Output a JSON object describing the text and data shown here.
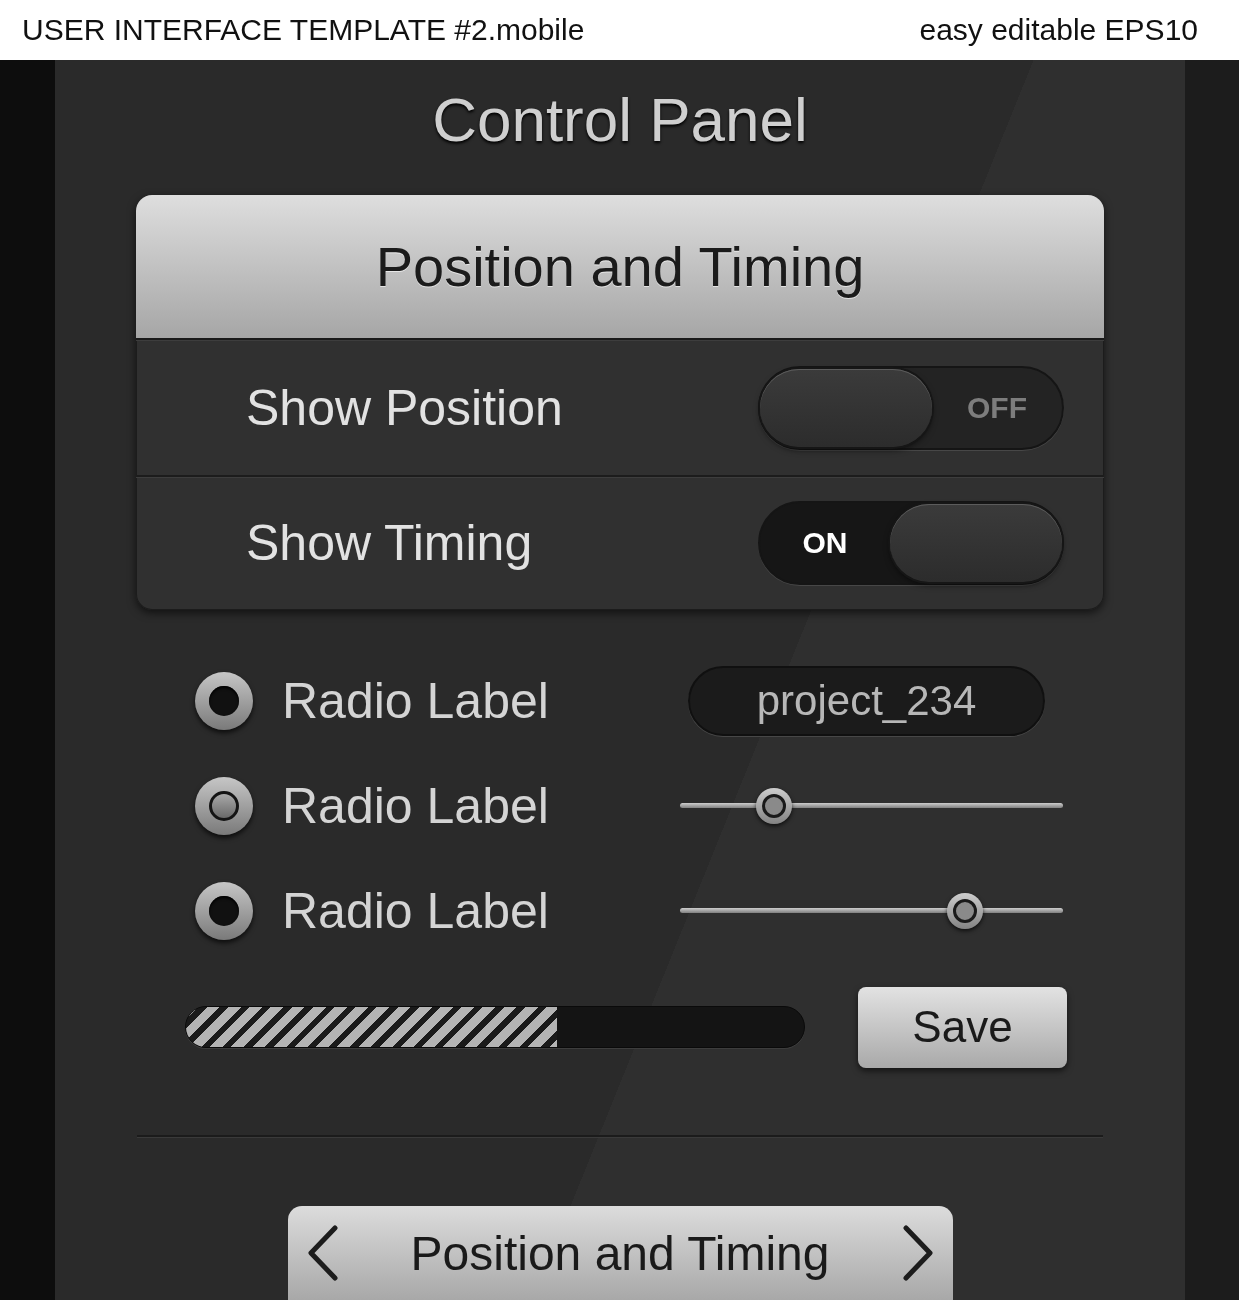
{
  "header": {
    "title": "USER INTERFACE TEMPLATE #2.mobile",
    "note": "easy editable EPS10"
  },
  "panel": {
    "title": "Control Panel"
  },
  "card": {
    "title": "Position and Timing",
    "toggles": [
      {
        "label": "Show Position",
        "on": false,
        "state_text": "OFF"
      },
      {
        "label": "Show Timing",
        "on": true,
        "state_text": "ON"
      }
    ]
  },
  "radios": [
    {
      "label": "Radio Label",
      "selected": false
    },
    {
      "label": "Radio Label",
      "selected": true
    },
    {
      "label": "Radio Label",
      "selected": false
    }
  ],
  "field": {
    "value": "project_234"
  },
  "sliders": [
    {
      "level": 0.22
    },
    {
      "level": 0.77
    }
  ],
  "progress": {
    "level": 0.6
  },
  "save_button": {
    "label": "Save"
  },
  "bottom_nav": {
    "title": "Position and Timing"
  }
}
